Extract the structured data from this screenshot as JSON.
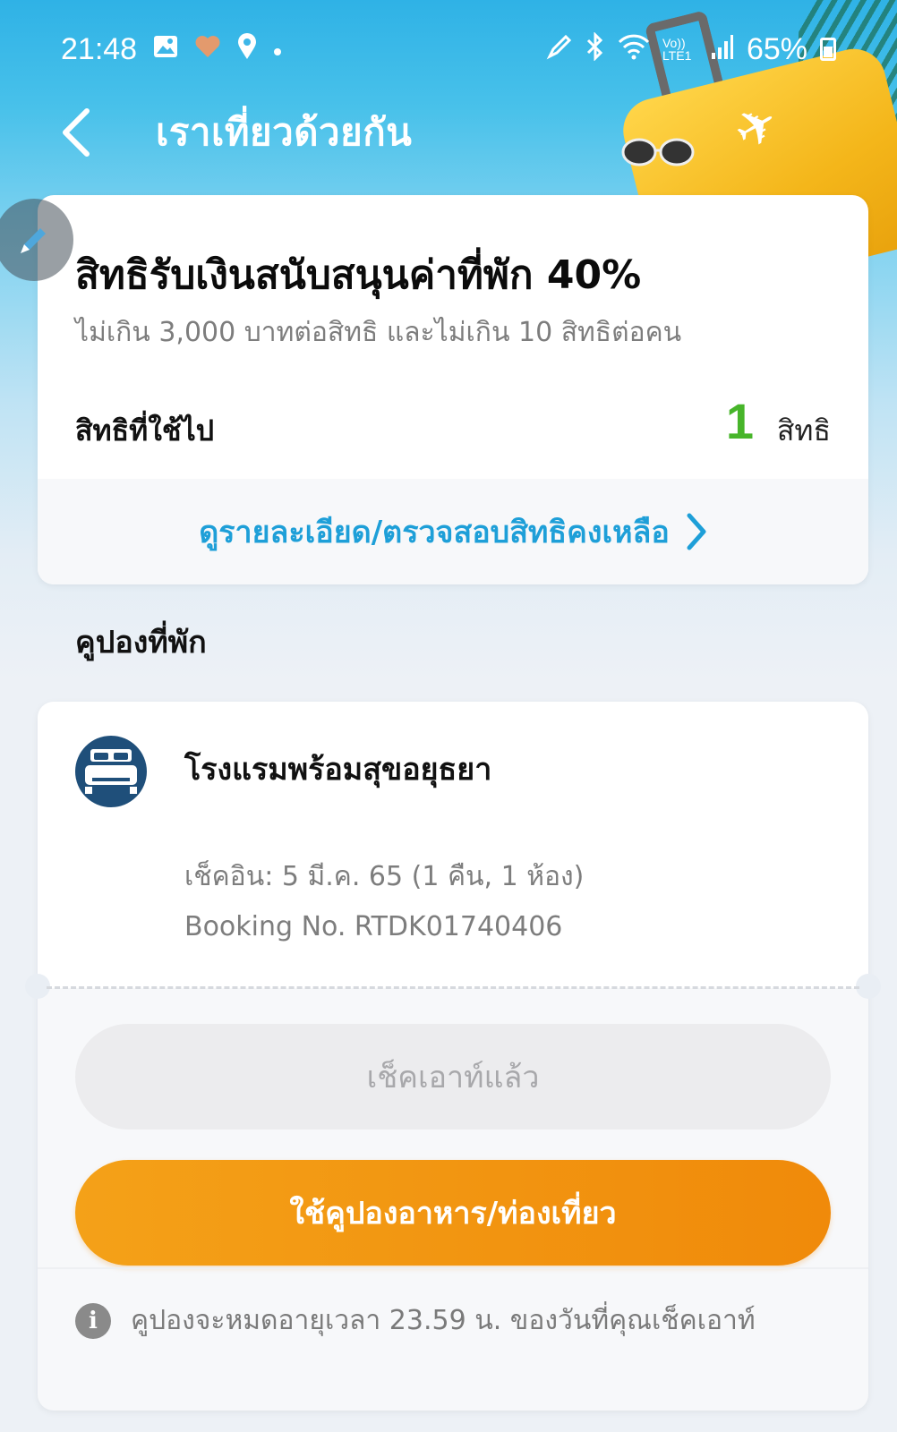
{
  "status_bar": {
    "time": "21:48",
    "battery": "65%",
    "left_icons": [
      "image-icon",
      "heart-icon",
      "location-icon",
      "dot-icon"
    ],
    "right_icons": [
      "pen-icon",
      "bluetooth-icon",
      "wifi-icon",
      "volte-icon",
      "signal-icon",
      "battery-icon"
    ],
    "volte_label": "Vo)) LTE1"
  },
  "header": {
    "title": "เราเที่ยวด้วยกัน"
  },
  "quota_card": {
    "title": "สิทธิรับเงินสนับสนุนค่าที่พัก 40%",
    "subtitle": "ไม่เกิน 3,000 บาทต่อสิทธิ และไม่เกิน 10 สิทธิต่อคน",
    "used_label": "สิทธิที่ใช้ไป",
    "used_count": "1",
    "used_unit": "สิทธิ",
    "detail_link": "ดูรายละเอียด/ตรวจสอบสิทธิคงเหลือ"
  },
  "coupon_section": {
    "heading": "คูปองที่พัก"
  },
  "coupon_card": {
    "hotel_name": "โรงแรมพร้อมสุขอยุธยา",
    "checkin": "เช็คอิน: 5 มี.ค. 65 (1 คืน, 1 ห้อง)",
    "booking": "Booking No. RTDK01740406",
    "checked_out_label": "เช็คเอาท์แล้ว",
    "use_coupon_label": "ใช้คูปองอาหาร/ท่องเที่ยว",
    "note": "คูปองจะหมดอายุเวลา 23.59 น. ของวันที่คุณเช็คเอาท์"
  },
  "colors": {
    "accent_blue": "#1e9fd8",
    "used_green": "#47b52a",
    "orange_button": "#f08a0a",
    "hotel_icon_bg": "#1f4f7a"
  }
}
